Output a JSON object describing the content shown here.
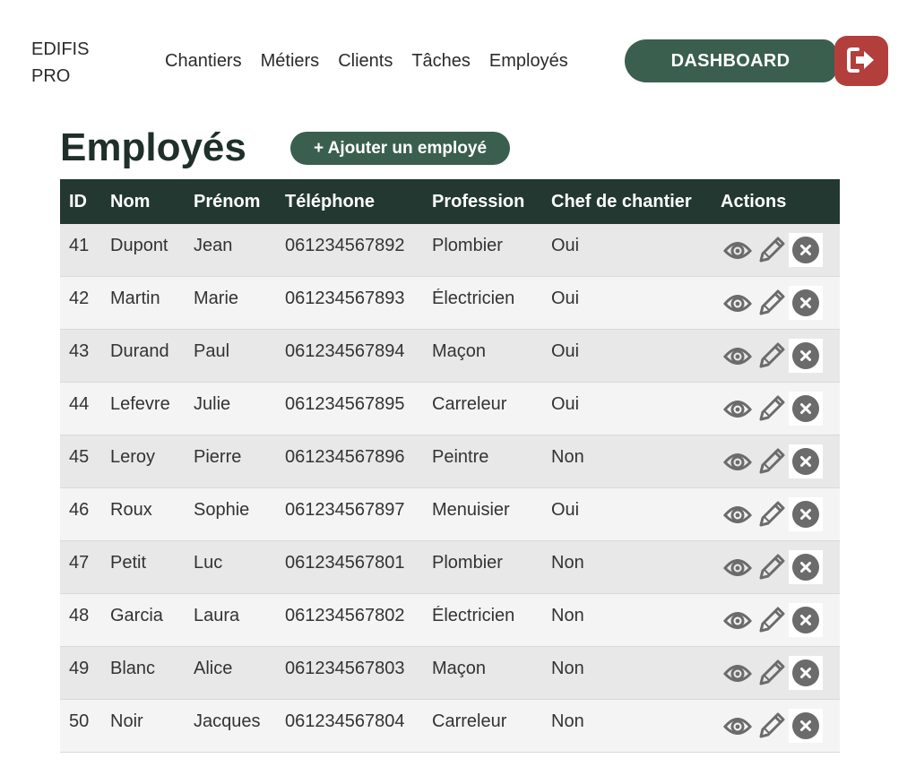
{
  "header": {
    "brand_line1": "EDIFIS",
    "brand_line2": "PRO",
    "nav": [
      "Chantiers",
      "Métiers",
      "Clients",
      "Tâches",
      "Employés"
    ],
    "dashboard_label": "DASHBOARD",
    "logout_icon": "logout-icon"
  },
  "page": {
    "title": "Employés",
    "add_label": "+ Ajouter un employé"
  },
  "table": {
    "columns": [
      "ID",
      "Nom",
      "Prénom",
      "Téléphone",
      "Profession",
      "Chef de chantier",
      "Actions"
    ],
    "rows": [
      {
        "id": "41",
        "nom": "Dupont",
        "prenom": "Jean",
        "tel": "061234567892",
        "profession": "Plombier",
        "chef": "Oui"
      },
      {
        "id": "42",
        "nom": "Martin",
        "prenom": "Marie",
        "tel": "061234567893",
        "profession": "Électricien",
        "chef": "Oui"
      },
      {
        "id": "43",
        "nom": "Durand",
        "prenom": "Paul",
        "tel": "061234567894",
        "profession": "Maçon",
        "chef": "Oui"
      },
      {
        "id": "44",
        "nom": "Lefevre",
        "prenom": "Julie",
        "tel": "061234567895",
        "profession": "Carreleur",
        "chef": "Oui"
      },
      {
        "id": "45",
        "nom": "Leroy",
        "prenom": "Pierre",
        "tel": "061234567896",
        "profession": "Peintre",
        "chef": "Non"
      },
      {
        "id": "46",
        "nom": "Roux",
        "prenom": "Sophie",
        "tel": "061234567897",
        "profession": "Menuisier",
        "chef": "Oui"
      },
      {
        "id": "47",
        "nom": "Petit",
        "prenom": "Luc",
        "tel": "061234567801",
        "profession": "Plombier",
        "chef": "Non"
      },
      {
        "id": "48",
        "nom": "Garcia",
        "prenom": "Laura",
        "tel": "061234567802",
        "profession": "Électricien",
        "chef": "Non"
      },
      {
        "id": "49",
        "nom": "Blanc",
        "prenom": "Alice",
        "tel": "061234567803",
        "profession": "Maçon",
        "chef": "Non"
      },
      {
        "id": "50",
        "nom": "Noir",
        "prenom": "Jacques",
        "tel": "061234567804",
        "profession": "Carreleur",
        "chef": "Non"
      }
    ],
    "action_icons": [
      "eye-icon",
      "pencil-icon",
      "close-circle-icon"
    ]
  },
  "colors": {
    "primary": "#3a5f4e",
    "header_dark": "#233830",
    "danger": "#b23f3c",
    "icon_gray": "#6b6b6b"
  }
}
